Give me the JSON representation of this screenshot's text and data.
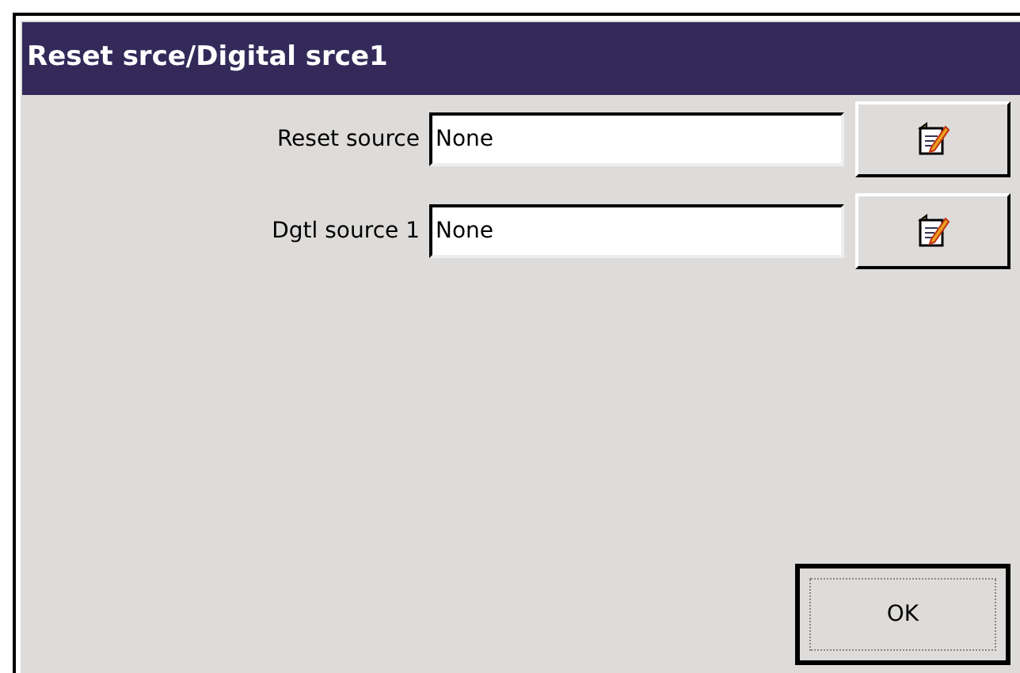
{
  "window": {
    "title": "Reset srce/Digital srce1"
  },
  "fields": [
    {
      "label": "Reset source",
      "value": "None"
    },
    {
      "label": "Dgtl source 1",
      "value": "None"
    }
  ],
  "buttons": [
    {
      "label": "OK",
      "focused": true
    }
  ]
}
